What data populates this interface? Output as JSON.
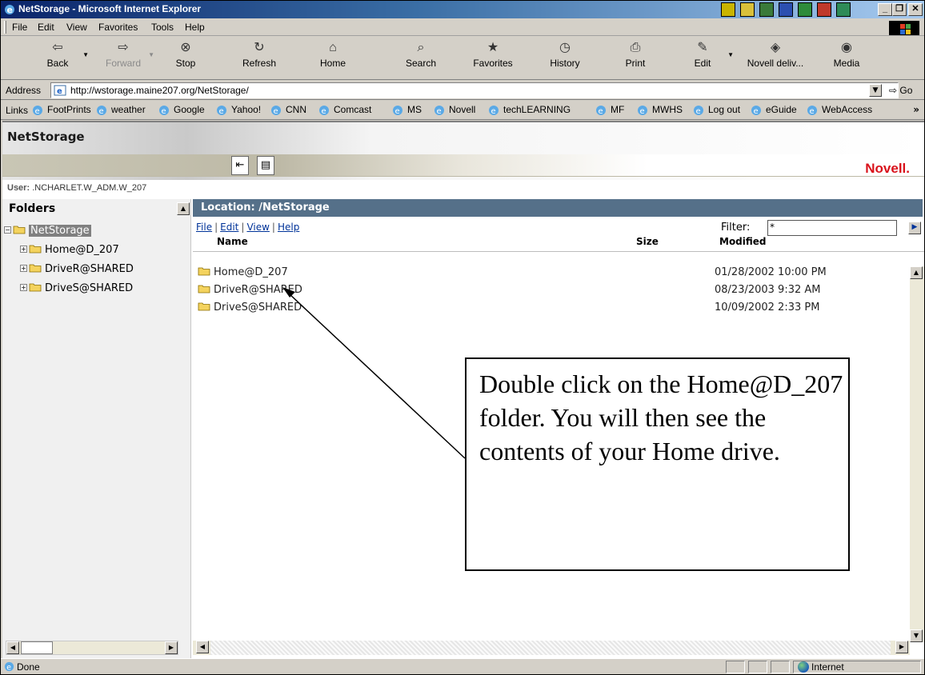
{
  "window": {
    "title": "NetStorage - Microsoft Internet Explorer",
    "buttons": [
      "_",
      "❐",
      "✕"
    ]
  },
  "menu": [
    "File",
    "Edit",
    "View",
    "Favorites",
    "Tools",
    "Help"
  ],
  "toolbar": [
    {
      "label": "Back",
      "icon": "back-arrow-icon",
      "glyph": "⇦"
    },
    {
      "label": "Forward",
      "icon": "forward-arrow-icon",
      "glyph": "⇨"
    },
    {
      "label": "Stop",
      "icon": "stop-icon",
      "glyph": "⊗"
    },
    {
      "label": "Refresh",
      "icon": "refresh-icon",
      "glyph": "↻"
    },
    {
      "label": "Home",
      "icon": "home-icon",
      "glyph": "⌂"
    },
    {
      "label": "Search",
      "icon": "search-icon",
      "glyph": "⌕"
    },
    {
      "label": "Favorites",
      "icon": "favorites-icon",
      "glyph": "★"
    },
    {
      "label": "History",
      "icon": "history-icon",
      "glyph": "◷"
    },
    {
      "label": "Print",
      "icon": "print-icon",
      "glyph": "⎙"
    },
    {
      "label": "Edit",
      "icon": "edit-icon",
      "glyph": "✎"
    },
    {
      "label": "Novell deliv...",
      "icon": "novell-delivery-icon",
      "glyph": "◈"
    },
    {
      "label": "Media",
      "icon": "media-icon",
      "glyph": "◉"
    }
  ],
  "address": {
    "label": "Address",
    "url": "http://wstorage.maine207.org/NetStorage/",
    "go": "Go"
  },
  "links": {
    "label": "Links",
    "items": [
      "FootPrints",
      "weather",
      "Google",
      "Yahoo!",
      "CNN",
      "Comcast",
      "MS",
      "Novell",
      "techLEARNING",
      "MF",
      "MWHS",
      "Log out",
      "eGuide",
      "WebAccess"
    ],
    "more": "»"
  },
  "netstorage": {
    "title": "NetStorage",
    "brand": "Novell.",
    "user_label": "User:",
    "user_value": ".NCHARLET.W_ADM.W_207"
  },
  "folders": {
    "title": "Folders",
    "root": "NetStorage",
    "children": [
      "Home@D_207",
      "DriveR@SHARED",
      "DriveS@SHARED"
    ]
  },
  "location": {
    "title": "Location: /NetStorage",
    "menu": [
      "File",
      "Edit",
      "View",
      "Help"
    ],
    "filter_label": "Filter:",
    "filter_value": "*",
    "columns": {
      "name": "Name",
      "size": "Size",
      "modified": "Modified"
    },
    "rows": [
      {
        "name": "Home@D_207",
        "size": "",
        "modified": "01/28/2002 10:00 PM"
      },
      {
        "name": "DriveR@SHARED",
        "size": "",
        "modified": "08/23/2003 9:32 AM"
      },
      {
        "name": "DriveS@SHARED",
        "size": "",
        "modified": "10/09/2002 2:33 PM"
      }
    ]
  },
  "callout": {
    "text": "Double click on the Home@D_207 folder. You will then see the contents of your Home drive."
  },
  "status": {
    "text": "Done",
    "zone": "Internet"
  },
  "colors": {
    "titlebar": "#0a246a",
    "location_bar": "#557089",
    "novell_red": "#d9121b",
    "link_blue": "#003399",
    "folder_yellow": "#f4d35e"
  }
}
